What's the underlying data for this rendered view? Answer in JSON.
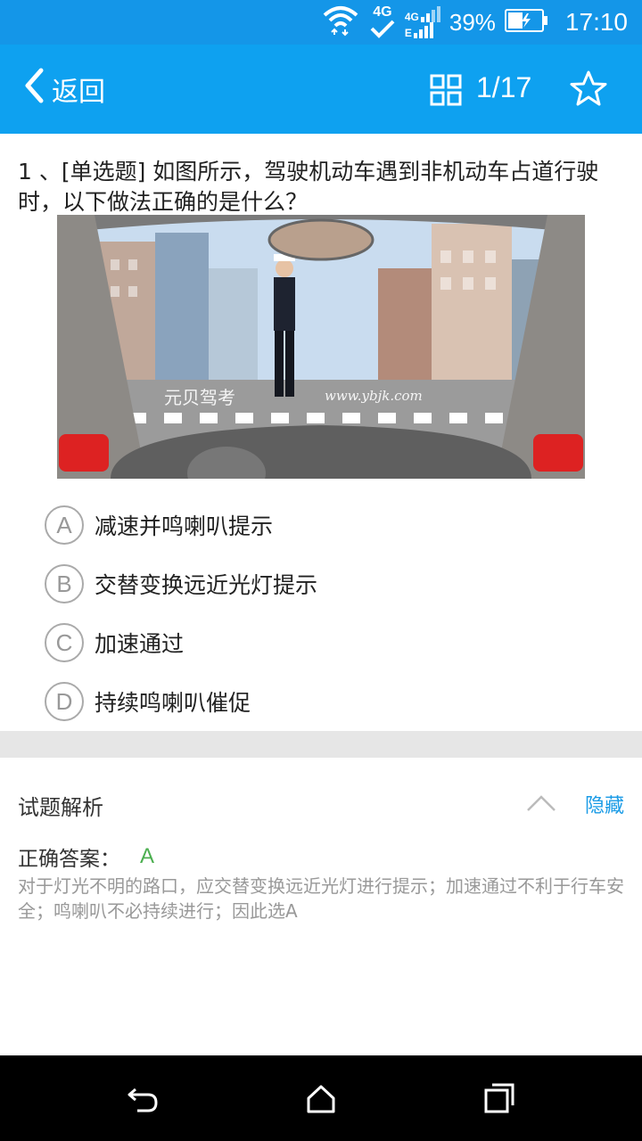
{
  "status_bar": {
    "network_type": "4G",
    "network_type2": "4G",
    "network_type3": "E",
    "battery_percent": "39%",
    "time": "17:10"
  },
  "app_bar": {
    "back_label": "返回",
    "progress": "1/17"
  },
  "question": {
    "text": "1 、[单选题]  如图所示，驾驶机动车遇到非机动车占道行驶时，以下做法正确的是什么？",
    "image_watermark_cn": "元贝驾考",
    "image_watermark_url": "www.ybjk.com"
  },
  "options": [
    {
      "letter": "A",
      "text": "减速并鸣喇叭提示"
    },
    {
      "letter": "B",
      "text": "交替变换远近光灯提示"
    },
    {
      "letter": "C",
      "text": "加速通过"
    },
    {
      "letter": "D",
      "text": "持续鸣喇叭催促"
    }
  ],
  "analysis": {
    "title": "试题解析",
    "hide_label": "隐藏",
    "answer_label": "正确答案：",
    "answer_value": "A",
    "explanation": "对于灯光不明的路口，应交替变换远近光灯进行提示；加速通过不利于行车安全；鸣喇叭不必持续进行；因此选A"
  },
  "colors": {
    "accent": "#0ea1f0",
    "status_bar": "#1496e8",
    "answer": "#4caf50",
    "link": "#1a9be6"
  }
}
